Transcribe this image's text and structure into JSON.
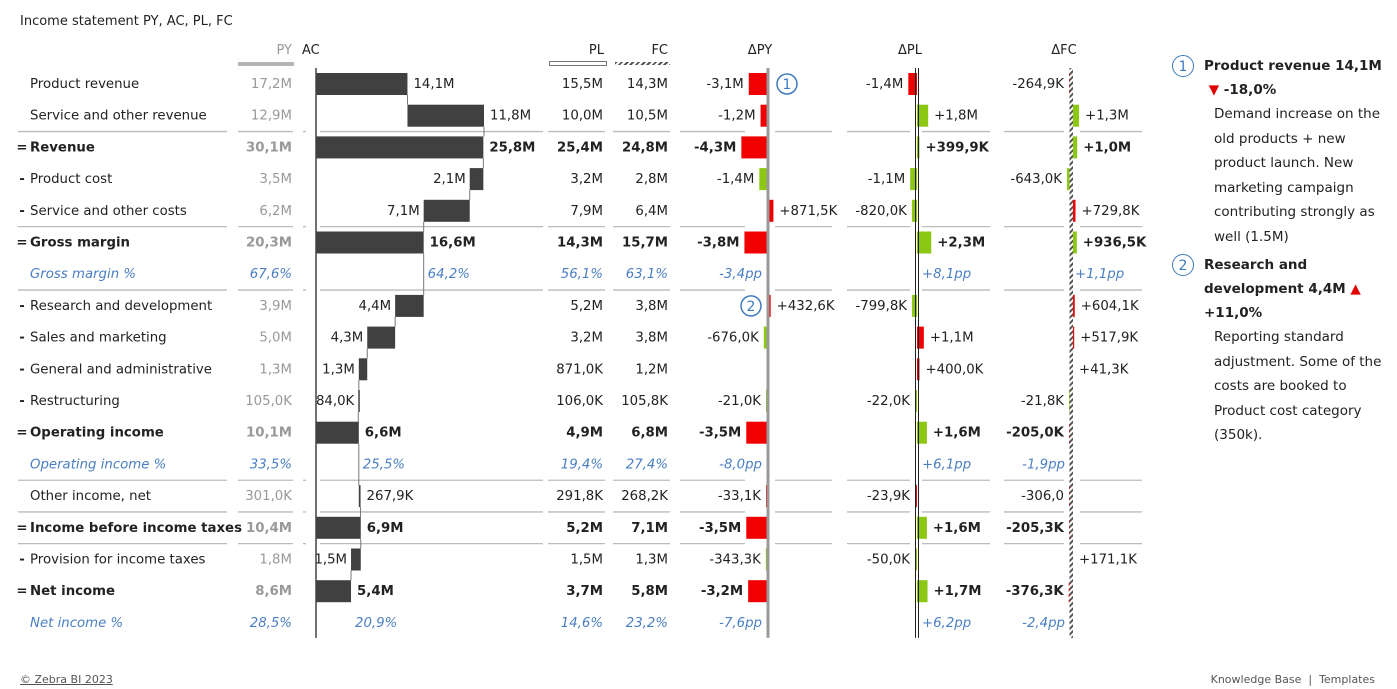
{
  "title": "Income statement PY, AC, PL, FC",
  "headers": {
    "py": "PY",
    "ac": "AC",
    "pl": "PL",
    "fc": "FC",
    "dpy": "ΔPY",
    "dpl": "ΔPL",
    "dfc": "ΔFC"
  },
  "colors": {
    "positive": "#8cc714",
    "negative": "#f00000",
    "ac_bar": "#404040",
    "percent_text": "#4a7fc1",
    "py_text": "#999999"
  },
  "chart_data": {
    "type": "table",
    "title": "Income statement PY, AC, PL, FC",
    "unit_note": "AC shown as waterfall; variance columns shown as bars (green = favorable, red = unfavorable)",
    "rows": [
      {
        "label": "Product revenue",
        "prefix": "",
        "kind": "item",
        "py": "17,2M",
        "ac": "14,1M",
        "pl": "15,5M",
        "fc": "14,3M",
        "dpy": "-3,1M",
        "dpl": "-1,4M",
        "dfc": "-264,9K",
        "ac_val": 14.1,
        "ac_start": 0,
        "ac_end": 14.1,
        "dpy_val": -3.1,
        "dpl_val": -1.4,
        "dfc_val": -0.2649,
        "dpy_good": false,
        "dpl_good": false,
        "dfc_good": false,
        "note": "1"
      },
      {
        "label": "Service and other revenue",
        "prefix": "",
        "kind": "item",
        "py": "12,9M",
        "ac": "11,8M",
        "pl": "10,0M",
        "fc": "10,5M",
        "dpy": "-1,2M",
        "dpl": "+1,8M",
        "dfc": "+1,3M",
        "ac_val": 11.8,
        "ac_start": 14.1,
        "ac_end": 25.9,
        "dpy_val": -1.2,
        "dpl_val": 1.8,
        "dfc_val": 1.3,
        "dpy_good": false,
        "dpl_good": true,
        "dfc_good": true
      },
      {
        "label": "Revenue",
        "prefix": "=",
        "kind": "total",
        "py": "30,1M",
        "ac": "25,8M",
        "pl": "25,4M",
        "fc": "24,8M",
        "dpy": "-4,3M",
        "dpl": "+399,9K",
        "dfc": "+1,0M",
        "ac_val": 25.8,
        "ac_start": 0,
        "ac_end": 25.8,
        "dpy_val": -4.3,
        "dpl_val": 0.3999,
        "dfc_val": 1.0,
        "dpy_good": false,
        "dpl_good": true,
        "dfc_good": true
      },
      {
        "label": "Product cost",
        "prefix": "-",
        "kind": "item",
        "py": "3,5M",
        "ac": "2,1M",
        "pl": "3,2M",
        "fc": "2,8M",
        "dpy": "-1,4M",
        "dpl": "-1,1M",
        "dfc": "-643,0K",
        "ac_val": 2.1,
        "ac_start": 23.7,
        "ac_end": 25.8,
        "dpy_val": -1.4,
        "dpl_val": -1.1,
        "dfc_val": -0.643,
        "dpy_good": true,
        "dpl_good": true,
        "dfc_good": true,
        "label_left": true
      },
      {
        "label": "Service and other costs",
        "prefix": "-",
        "kind": "item",
        "py": "6,2M",
        "ac": "7,1M",
        "pl": "7,9M",
        "fc": "6,4M",
        "dpy": "+871,5K",
        "dpl": "-820,0K",
        "dfc": "+729,8K",
        "ac_val": 7.1,
        "ac_start": 16.6,
        "ac_end": 23.7,
        "dpy_val": 0.8715,
        "dpl_val": -0.82,
        "dfc_val": 0.7298,
        "dpy_good": false,
        "dpl_good": true,
        "dfc_good": false,
        "label_left": true
      },
      {
        "label": "Gross margin",
        "prefix": "=",
        "kind": "total",
        "py": "20,3M",
        "ac": "16,6M",
        "pl": "14,3M",
        "fc": "15,7M",
        "dpy": "-3,8M",
        "dpl": "+2,3M",
        "dfc": "+936,5K",
        "ac_val": 16.6,
        "ac_start": 0,
        "ac_end": 16.6,
        "dpy_val": -3.8,
        "dpl_val": 2.3,
        "dfc_val": 0.9365,
        "dpy_good": false,
        "dpl_good": true,
        "dfc_good": true
      },
      {
        "label": "Gross margin %",
        "prefix": "",
        "kind": "pct",
        "py": "67,6%",
        "ac": "64,2%",
        "pl": "56,1%",
        "fc": "63,1%",
        "dpy": "-3,4pp",
        "dpl": "+8,1pp",
        "dfc": "+1,1pp",
        "ac_pos": 16.6
      },
      {
        "label": "Research and development",
        "prefix": "-",
        "kind": "item",
        "py": "3,9M",
        "ac": "4,4M",
        "pl": "5,2M",
        "fc": "3,8M",
        "dpy": "+432,6K",
        "dpl": "-799,8K",
        "dfc": "+604,1K",
        "ac_val": 4.4,
        "ac_start": 12.2,
        "ac_end": 16.6,
        "dpy_val": 0.4326,
        "dpl_val": -0.7998,
        "dfc_val": 0.6041,
        "dpy_good": false,
        "dpl_good": true,
        "dfc_good": false,
        "label_left": true,
        "note": "2"
      },
      {
        "label": "Sales and marketing",
        "prefix": "-",
        "kind": "item",
        "py": "5,0M",
        "ac": "4,3M",
        "pl": "3,2M",
        "fc": "3,8M",
        "dpy": "-676,0K",
        "dpl": "+1,1M",
        "dfc": "+517,9K",
        "ac_val": 4.3,
        "ac_start": 7.9,
        "ac_end": 12.2,
        "dpy_val": -0.676,
        "dpl_val": 1.1,
        "dfc_val": 0.5179,
        "dpy_good": true,
        "dpl_good": false,
        "dfc_good": false,
        "label_left": true
      },
      {
        "label": "General and administrative",
        "prefix": "-",
        "kind": "item",
        "py": "1,3M",
        "ac": "1,3M",
        "pl": "871,0K",
        "fc": "1,2M",
        "dpy": "",
        "dpl": "+400,0K",
        "dfc": "+41,3K",
        "ac_val": 1.3,
        "ac_start": 6.6,
        "ac_end": 7.9,
        "dpy_val": 0,
        "dpl_val": 0.4,
        "dfc_val": 0.0413,
        "dpy_good": true,
        "dpl_good": false,
        "dfc_good": false,
        "label_left": true
      },
      {
        "label": "Restructuring",
        "prefix": "-",
        "kind": "item",
        "py": "105,0K",
        "ac": "84,0K",
        "pl": "106,0K",
        "fc": "105,8K",
        "dpy": "-21,0K",
        "dpl": "-22,0K",
        "dfc": "-21,8K",
        "ac_val": 0.084,
        "ac_start": 6.516,
        "ac_end": 6.6,
        "dpy_val": -0.021,
        "dpl_val": -0.022,
        "dfc_val": -0.0218,
        "dpy_good": true,
        "dpl_good": true,
        "dfc_good": true,
        "label_left": true
      },
      {
        "label": "Operating income",
        "prefix": "=",
        "kind": "total",
        "py": "10,1M",
        "ac": "6,6M",
        "pl": "4,9M",
        "fc": "6,8M",
        "dpy": "-3,5M",
        "dpl": "+1,6M",
        "dfc": "-205,0K",
        "ac_val": 6.6,
        "ac_start": 0,
        "ac_end": 6.6,
        "dpy_val": -3.5,
        "dpl_val": 1.6,
        "dfc_val": -0.205,
        "dpy_good": false,
        "dpl_good": true,
        "dfc_good": false
      },
      {
        "label": "Operating income %",
        "prefix": "",
        "kind": "pct",
        "py": "33,5%",
        "ac": "25,5%",
        "pl": "19,4%",
        "fc": "27,4%",
        "dpy": "-8,0pp",
        "dpl": "+6,1pp",
        "dfc": "-1,9pp",
        "ac_pos": 6.6
      },
      {
        "label": "Other income, net",
        "prefix": "",
        "kind": "item",
        "py": "301,0K",
        "ac": "267,9K",
        "pl": "291,8K",
        "fc": "268,2K",
        "dpy": "-33,1K",
        "dpl": "-23,9K",
        "dfc": "-306,0",
        "ac_val": 0.2679,
        "ac_start": 6.6,
        "ac_end": 6.8679,
        "dpy_val": -0.0331,
        "dpl_val": -0.0239,
        "dfc_val": -0.0003,
        "dpy_good": false,
        "dpl_good": false,
        "dfc_good": false
      },
      {
        "label": "Income before income taxes",
        "prefix": "=",
        "kind": "total",
        "py": "10,4M",
        "ac": "6,9M",
        "pl": "5,2M",
        "fc": "7,1M",
        "dpy": "-3,5M",
        "dpl": "+1,6M",
        "dfc": "-205,3K",
        "ac_val": 6.9,
        "ac_start": 0,
        "ac_end": 6.9,
        "dpy_val": -3.5,
        "dpl_val": 1.6,
        "dfc_val": -0.2053,
        "dpy_good": false,
        "dpl_good": true,
        "dfc_good": false
      },
      {
        "label": "Provision for income taxes",
        "prefix": "-",
        "kind": "item",
        "py": "1,8M",
        "ac": "1,5M",
        "pl": "1,5M",
        "fc": "1,3M",
        "dpy": "-343,3K",
        "dpl": "-50,0K",
        "dfc": "+171,1K",
        "ac_val": 1.5,
        "ac_start": 5.4,
        "ac_end": 6.9,
        "dpy_val": -0.3433,
        "dpl_val": -0.05,
        "dfc_val": 0.1711,
        "dpy_good": true,
        "dpl_good": true,
        "dfc_good": false,
        "label_left": true
      },
      {
        "label": "Net income",
        "prefix": "=",
        "kind": "total",
        "py": "8,6M",
        "ac": "5,4M",
        "pl": "3,7M",
        "fc": "5,8M",
        "dpy": "-3,2M",
        "dpl": "+1,7M",
        "dfc": "-376,3K",
        "ac_val": 5.4,
        "ac_start": 0,
        "ac_end": 5.4,
        "dpy_val": -3.2,
        "dpl_val": 1.7,
        "dfc_val": -0.3763,
        "dpy_good": false,
        "dpl_good": true,
        "dfc_good": false
      },
      {
        "label": "Net income %",
        "prefix": "",
        "kind": "pct",
        "py": "28,5%",
        "ac": "20,9%",
        "pl": "14,6%",
        "fc": "23,2%",
        "dpy": "-7,6pp",
        "dpl": "+6,2pp",
        "dfc": "-2,4pp",
        "ac_pos": 5.4
      }
    ],
    "separators_after": [
      1,
      4,
      6,
      12,
      13,
      14
    ]
  },
  "notes": [
    {
      "num": "1",
      "title": "Product revenue 14,1M",
      "delta_icon": "triangle-down",
      "delta": "-18,0%",
      "body": "Demand increase on the old products + new product launch. New marketing campaign contributing strongly as well (1.5M)"
    },
    {
      "num": "2",
      "title": "Research and development 4,4M",
      "delta_icon": "triangle-up",
      "delta": "+11,0%",
      "body": "Reporting standard adjustment. Some of the costs are booked to Product cost category (350k)."
    }
  ],
  "footer": {
    "copyright": "© Zebra BI 2023",
    "links": "Knowledge Base  |  Templates"
  }
}
